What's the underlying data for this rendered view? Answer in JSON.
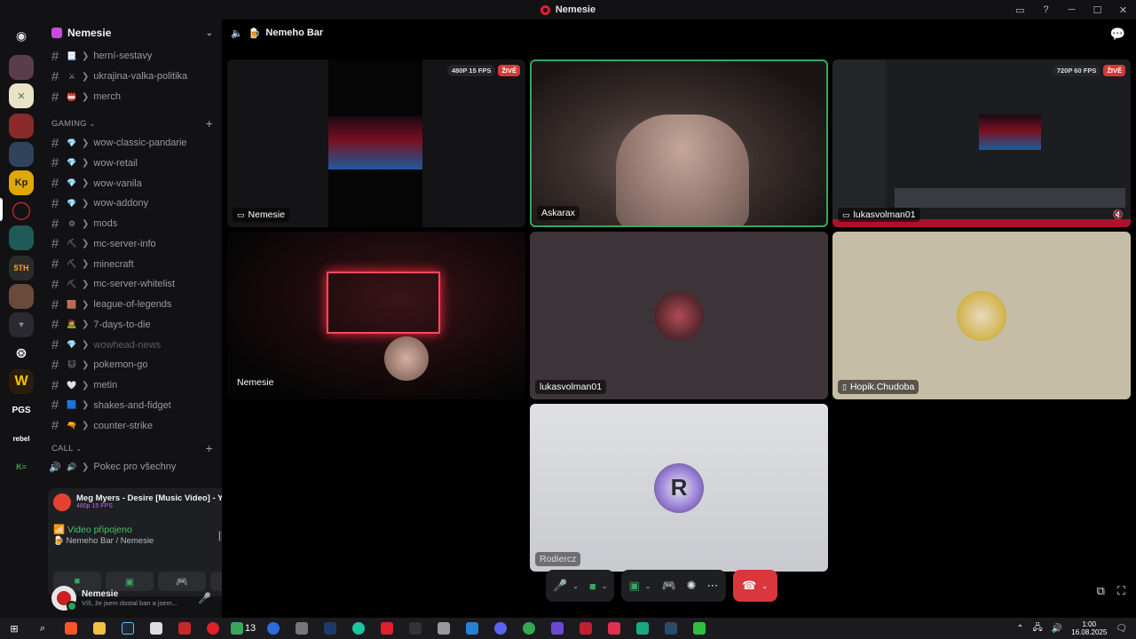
{
  "window": {
    "title": "Nemesie"
  },
  "guild": {
    "name": "Nemesie"
  },
  "channels_top": [
    {
      "emoji": "📃",
      "name": "herní-sestavy"
    },
    {
      "emoji": "⚔",
      "name": "ukrajina-valka-politika"
    },
    {
      "emoji": "📛",
      "name": "merch"
    }
  ],
  "categories": {
    "gaming": "GAMING",
    "call": "CALL"
  },
  "gaming_channels": [
    {
      "emoji": "💎",
      "name": "wow-classic-pandarie",
      "muted": false
    },
    {
      "emoji": "💎",
      "name": "wow-retail",
      "muted": false
    },
    {
      "emoji": "💎",
      "name": "wow-vanila",
      "muted": false
    },
    {
      "emoji": "💎",
      "name": "wow-addony",
      "muted": false
    },
    {
      "emoji": "⚙",
      "name": "mods",
      "muted": false
    },
    {
      "emoji": "⛏",
      "name": "mc-server-info",
      "muted": false
    },
    {
      "emoji": "⛏",
      "name": "minecraft",
      "muted": false
    },
    {
      "emoji": "⛏",
      "name": "mc-server-whitelist",
      "muted": false
    },
    {
      "emoji": "🟫",
      "name": "league-of-legends",
      "muted": false
    },
    {
      "emoji": "🧟",
      "name": "7-days-to-die",
      "muted": false
    },
    {
      "emoji": "💎",
      "name": "wowhead-news",
      "muted": true
    },
    {
      "emoji": "🐱",
      "name": "pokemon-go",
      "muted": false
    },
    {
      "emoji": "🤍",
      "name": "metin",
      "muted": false
    },
    {
      "emoji": "🟦",
      "name": "shakes-and-fidget",
      "muted": false
    },
    {
      "emoji": "🔫",
      "name": "counter-strike",
      "muted": false
    }
  ],
  "call_channels": [
    {
      "emoji": "🔊",
      "name": "Pokec pro všechny"
    }
  ],
  "activity": {
    "title": "Meg Myers - Desire [Music Video] - YouTu...",
    "sub": "480p 15 FPS",
    "voice_status": "Video připojeno",
    "voice_location": "Nemeho Bar / Nemesie"
  },
  "user": {
    "name": "Nemesie",
    "status": "Víš, že jsem dostal ban a jsem..."
  },
  "stage": {
    "channel": "Nemeho Bar"
  },
  "tiles": {
    "nemesie_stream": {
      "name": "Nemesie",
      "quality": "480P 15 FPS",
      "live": "ŽIVĚ"
    },
    "askarax": {
      "name": "Askarax"
    },
    "lukas_stream": {
      "name": "lukasvolman01",
      "quality": "720P 60 FPS",
      "live": "ŽIVĚ"
    },
    "nemesie_cam": {
      "name": "Nemesie"
    },
    "lukas_cam": {
      "name": "lukasvolman01"
    },
    "hopik": {
      "name": "Hopik.Chudoba"
    },
    "rodiercz": {
      "name": "Rodiercz"
    }
  },
  "taskbar": {
    "badge_count": "13",
    "time": "1:00",
    "date": "16.08.2025"
  },
  "colors": {
    "accent_green": "#3ba55c",
    "live_red": "#da373c",
    "speaking_border": "#3ba55c"
  }
}
